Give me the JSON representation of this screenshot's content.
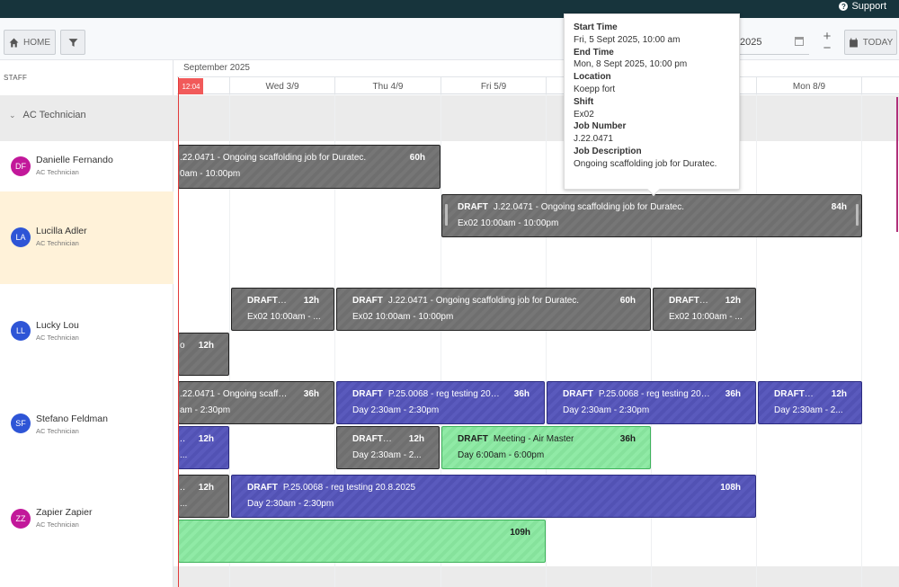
{
  "topbar": {
    "support_label": "Support"
  },
  "toolbar": {
    "home_label": "HOME",
    "today_label": "TODAY",
    "date_value": "/2025",
    "zoom_in": "+",
    "zoom_out": "−"
  },
  "staff_header": "STAFF",
  "month_label": "September 2025",
  "now_time": "12:04",
  "days": [
    "Wed 3/9",
    "Thu 4/9",
    "Fri 5/9",
    "",
    "Mon 8/9"
  ],
  "group": {
    "label": "AC Technician"
  },
  "people": [
    {
      "initials": "DF",
      "name": "Danielle Fernando",
      "role": "AC Technician",
      "color": "#c2189a"
    },
    {
      "initials": "LA",
      "name": "Lucilla Adler",
      "role": "AC Technician",
      "color": "#2e55d6"
    },
    {
      "initials": "LL",
      "name": "Lucky Lou",
      "role": "AC Technician",
      "color": "#2e55d6"
    },
    {
      "initials": "SF",
      "name": "Stefano Feldman",
      "role": "AC Technician",
      "color": "#2e55d6"
    },
    {
      "initials": "ZZ",
      "name": "Zapier Zapier",
      "role": "AC Technician",
      "color": "#c2189a"
    }
  ],
  "shifts": [
    {
      "status": "",
      "title": ".22.0471 - Ongoing scaffolding job for Duratec.",
      "hours": "60h",
      "detail": "0am - 10:00pm"
    },
    {
      "status": "DRAFT",
      "title": "J.22.0471 - Ongoing scaffolding job for Duratec.",
      "hours": "84h",
      "detail": "Ex02 10:00am - 10:00pm"
    },
    {
      "status": "DRAFT",
      "title": "J.2...",
      "hours": "12h",
      "detail": "Ex02 10:00am - ..."
    },
    {
      "status": "DRAFT",
      "title": "J.22.0471 - Ongoing scaffolding job for Duratec.",
      "hours": "60h",
      "detail": "Ex02 10:00am - 10:00pm"
    },
    {
      "status": "DRAFT",
      "title": "J.2...",
      "hours": "12h",
      "detail": "Ex02 10:00am - ..."
    },
    {
      "status": "",
      "title": "ol...",
      "hours": "12h",
      "detail": ""
    },
    {
      "status": "",
      "title": ".22.0471 - Ongoing scaffol...",
      "hours": "36h",
      "detail": "am - 2:30pm"
    },
    {
      "status": "DRAFT",
      "title": "P.25.0068 - reg testing 20.8....",
      "hours": "36h",
      "detail": "Day 2:30am - 2:30pm"
    },
    {
      "status": "DRAFT",
      "title": "P.25.0068 - reg testing 20.8....",
      "hours": "36h",
      "detail": "Day 2:30am - 2:30pm"
    },
    {
      "status": "DRAFT",
      "title": "P.2...",
      "hours": "12h",
      "detail": "Day 2:30am - 2..."
    },
    {
      "status": "",
      "title": ".2...",
      "hours": "12h",
      "detail": "..."
    },
    {
      "status": "DRAFT",
      "title": "J.2...",
      "hours": "12h",
      "detail": "Day 2:30am - 2..."
    },
    {
      "status": "DRAFT",
      "title": "Meeting - Air Master",
      "hours": "36h",
      "detail": "Day 6:00am - 6:00pm"
    },
    {
      "status": "",
      "title": ".2...",
      "hours": "12h",
      "detail": "..."
    },
    {
      "status": "DRAFT",
      "title": "P.25.0068 - reg testing 20.8.2025",
      "hours": "108h",
      "detail": "Day 2:30am - 2:30pm"
    },
    {
      "status": "",
      "title": "",
      "hours": "109h",
      "detail": ""
    }
  ],
  "tooltip": {
    "start_time_label": "Start Time",
    "start_time": "Fri, 5 Sept 2025, 10:00 am",
    "end_time_label": "End Time",
    "end_time": "Mon, 8 Sept 2025, 10:00 pm",
    "location_label": "Location",
    "location": "Koepp fort",
    "shift_label": "Shift",
    "shift": "Ex02",
    "job_number_label": "Job Number",
    "job_number": "J.22.0471",
    "job_desc_label": "Job Description",
    "job_desc": "Ongoing scaffolding job for Duratec."
  }
}
